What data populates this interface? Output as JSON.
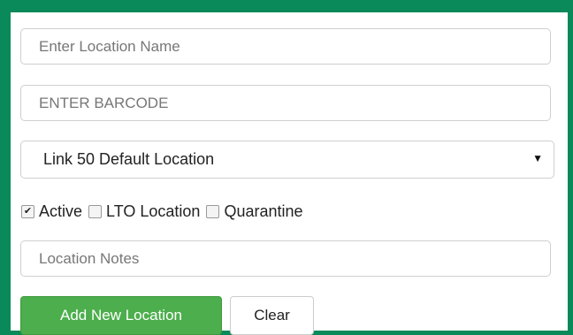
{
  "form": {
    "location_name_placeholder": "Enter Location Name",
    "barcode_placeholder": "ENTER BARCODE",
    "default_location_selected": "Link 50 Default Location",
    "checkboxes": [
      {
        "label": "Active",
        "checked": true
      },
      {
        "label": "LTO Location",
        "checked": false
      },
      {
        "label": "Quarantine",
        "checked": false
      }
    ],
    "notes_placeholder": "Location Notes",
    "add_button_label": "Add New Location",
    "clear_button_label": "Clear"
  },
  "colors": {
    "frame": "#0a8a5a",
    "primary_button": "#4cae4c"
  },
  "icons": {
    "dropdown_arrow": "chevron-down-icon",
    "checkmark": "check-icon"
  }
}
